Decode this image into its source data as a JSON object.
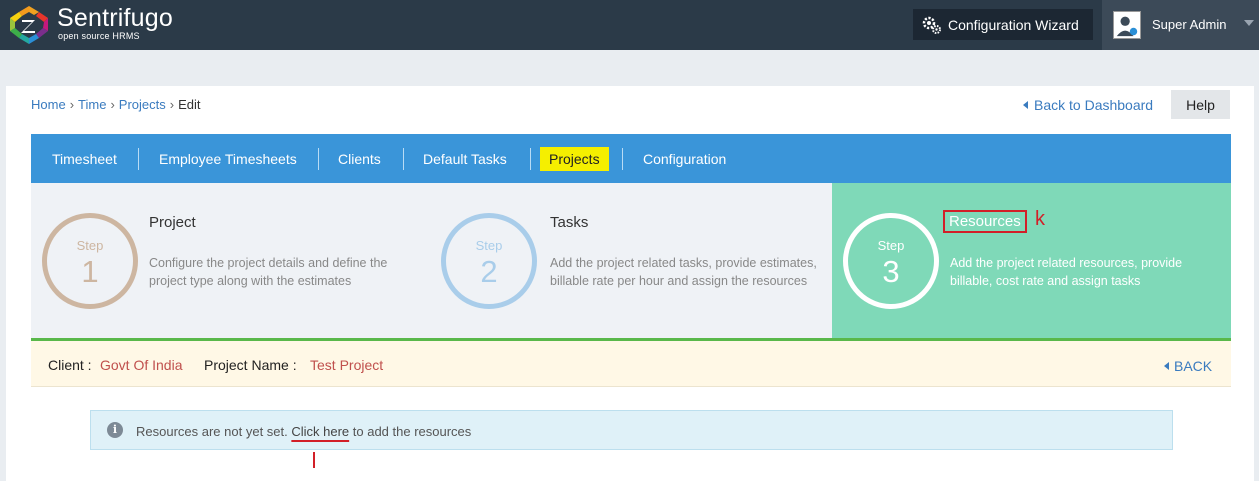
{
  "brand": {
    "name": "Sentrifugo",
    "tagline": "open source HRMS"
  },
  "header": {
    "wizard_label": "Configuration Wizard",
    "user_name": "Super Admin"
  },
  "breadcrumb": {
    "home": "Home",
    "time": "Time",
    "projects": "Projects",
    "current": "Edit",
    "sep1": "›",
    "sep2": "›",
    "sep3": "›"
  },
  "actions": {
    "back_dashboard": "Back to Dashboard",
    "help": "Help"
  },
  "nav": {
    "items": [
      "Timesheet",
      "Employee Timesheets",
      "Clients",
      "Default Tasks",
      "Projects",
      "Configuration"
    ],
    "active": "Projects"
  },
  "steps": [
    {
      "label": "Step",
      "number": "1",
      "title": "Project",
      "desc": "Configure the project details and define the project type along with the estimates",
      "color": "#cdb6a1"
    },
    {
      "label": "Step",
      "number": "2",
      "title": "Tasks",
      "desc": "Add the project related tasks, provide estimates, billable rate per hour and assign the resources",
      "color": "#a9cdea"
    },
    {
      "label": "Step",
      "number": "3",
      "title": "Resources",
      "desc": "Add the project related resources, provide billable, cost rate and assign tasks",
      "color": "#ffffff"
    }
  ],
  "annotation_k": "k",
  "project_info": {
    "client_label": "Client :",
    "client_value": "Govt Of India",
    "project_label": "Project Name :",
    "project_value": "Test Project",
    "back_label": "BACK"
  },
  "alert": {
    "icon": "i",
    "text_before": "Resources are not yet set. ",
    "link": "Click here",
    "text_after": " to add the resources"
  }
}
